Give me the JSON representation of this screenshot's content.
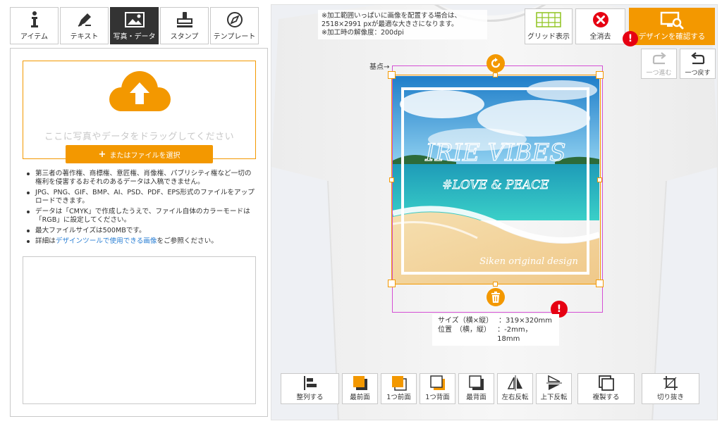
{
  "tabs": [
    {
      "label": "アイテム",
      "icon": "info-i-icon",
      "active": false
    },
    {
      "label": "テキスト",
      "icon": "pen-icon",
      "active": false
    },
    {
      "label": "写真・データ",
      "icon": "image-icon",
      "active": true
    },
    {
      "label": "スタンプ",
      "icon": "stamp-icon",
      "active": false
    },
    {
      "label": "テンプレート",
      "icon": "compass-icon",
      "active": false
    }
  ],
  "upload": {
    "drop_text": "ここに写真やデータをドラッグしてください",
    "button_plus": "+",
    "button_label": "またはファイルを選択"
  },
  "notes": {
    "n1": "第三者の著作権、商標権、意匠権、肖像権、パブリシティ権など一切の権利を侵害するおそれのあるデータは入稿できません。",
    "n2": "JPG、PNG、GIF、BMP、AI、PSD、PDF、EPS形式のファイルをアップロードできます。",
    "n3": "データは「CMYK」で作成したうえで、ファイル自体のカラーモードは「RGB」に設定してください。",
    "n4": "最大ファイルサイズは500MBです。",
    "n5_prefix": "詳細は",
    "n5_link": "デザインツールで使用できる画像",
    "n5_suffix": "をご参照ください。"
  },
  "canvas_note": {
    "line1": "※加工範囲いっぱいに画像を配置する場合は、",
    "line2": "2518×2991 pxが最適な大きさになります。",
    "line3": "※加工時の解像度：200dpi"
  },
  "top_buttons": {
    "grid": "グリッド表示",
    "clear": "全消去",
    "confirm": "デザインを確認する",
    "alert": "!"
  },
  "history": {
    "redo": "一つ進む",
    "undo": "一つ戻す"
  },
  "design": {
    "base_label": "基点→",
    "title": "IRIE VIBES",
    "subtitle": "#LOVE & PEACE",
    "signature": "Siken original design",
    "alert": "!"
  },
  "size_info": {
    "size_key": "サイズ（横×縦）",
    "size_val": "：319×320mm",
    "pos_key": "位置　（横，縦）",
    "pos_val": "：-2mm，18mm"
  },
  "toolbar": {
    "align": "整列する",
    "front": "最前面",
    "forward": "1つ前面",
    "backward": "1つ背面",
    "back": "最背面",
    "flip_h": "左右反転",
    "flip_v": "上下反転",
    "duplicate": "複製する",
    "crop": "切り抜き"
  },
  "colors": {
    "accent": "#f39800",
    "alert": "#e60012",
    "print_area": "#d44fd4",
    "link": "#2a7fd4"
  }
}
